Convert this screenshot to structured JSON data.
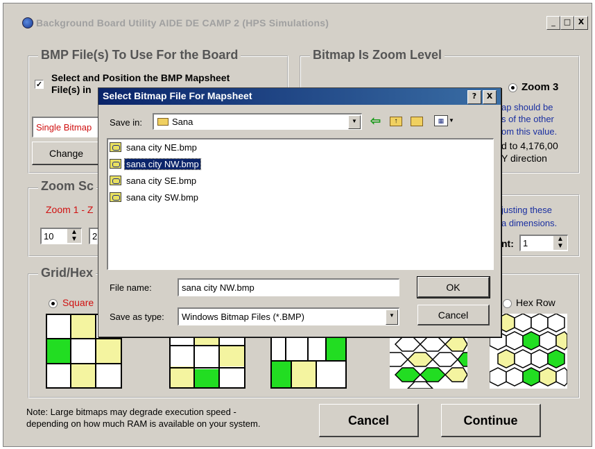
{
  "window": {
    "title": "Background Board Utility  AIDE DE CAMP 2  (HPS Simulations)",
    "minimize": "_",
    "maximize": "□",
    "close": "X"
  },
  "bmp_group": {
    "title": "BMP File(s) To Use For the  Board",
    "checkbox_label_line1": "Select and Position the BMP Mapsheet",
    "checkbox_label_line2": "File(s) in",
    "checkbox_checked": true,
    "file_field_value": "Single Bitmap",
    "change_button": "Change"
  },
  "zoom_group": {
    "title": "Bitmap Is Zoom Level",
    "radio_zoom3_label": "Zoom 3",
    "info_lines": [
      "ap should be",
      "s of the other",
      "om this value.",
      "d to 4,176,00",
      "Y direction"
    ]
  },
  "zoom_scale_group": {
    "title": "Zoom Sc",
    "red_label": "Zoom 1 - Z",
    "spinner1_value": "10",
    "spinner2_value": "2"
  },
  "right_mid": {
    "info_lines": [
      "justing these",
      "a dimensions."
    ],
    "count_label": "nt:",
    "count_value": "1"
  },
  "grid_group": {
    "title": "Grid/Hex",
    "radio_square_label": "Square",
    "radio_hexrow_label": "Hex Row"
  },
  "footer": {
    "note_line1": "Note:  Large bitmaps may degrade execution speed -",
    "note_line2": "depending on how much RAM is available on your system.",
    "cancel_button": "Cancel",
    "continue_button": "Continue"
  },
  "dialog": {
    "title": "Select Bitmap File For Mapsheet",
    "help_button": "?",
    "close_button": "X",
    "save_in_label": "Save in:",
    "save_in_value": "Sana",
    "files": [
      "sana city NE.bmp",
      "sana city NW.bmp",
      "sana city SE.bmp",
      "sana city SW.bmp"
    ],
    "selected_index": 1,
    "file_name_label": "File name:",
    "file_name_value": "sana city NW.bmp",
    "save_as_type_label": "Save as type:",
    "save_as_type_value": "Windows Bitmap Files (*.BMP)",
    "ok_button": "OK",
    "cancel_button": "Cancel"
  },
  "colors": {
    "green": "#22dd22",
    "yellow": "#f4f4a0",
    "title_blue": "#0a246a"
  }
}
